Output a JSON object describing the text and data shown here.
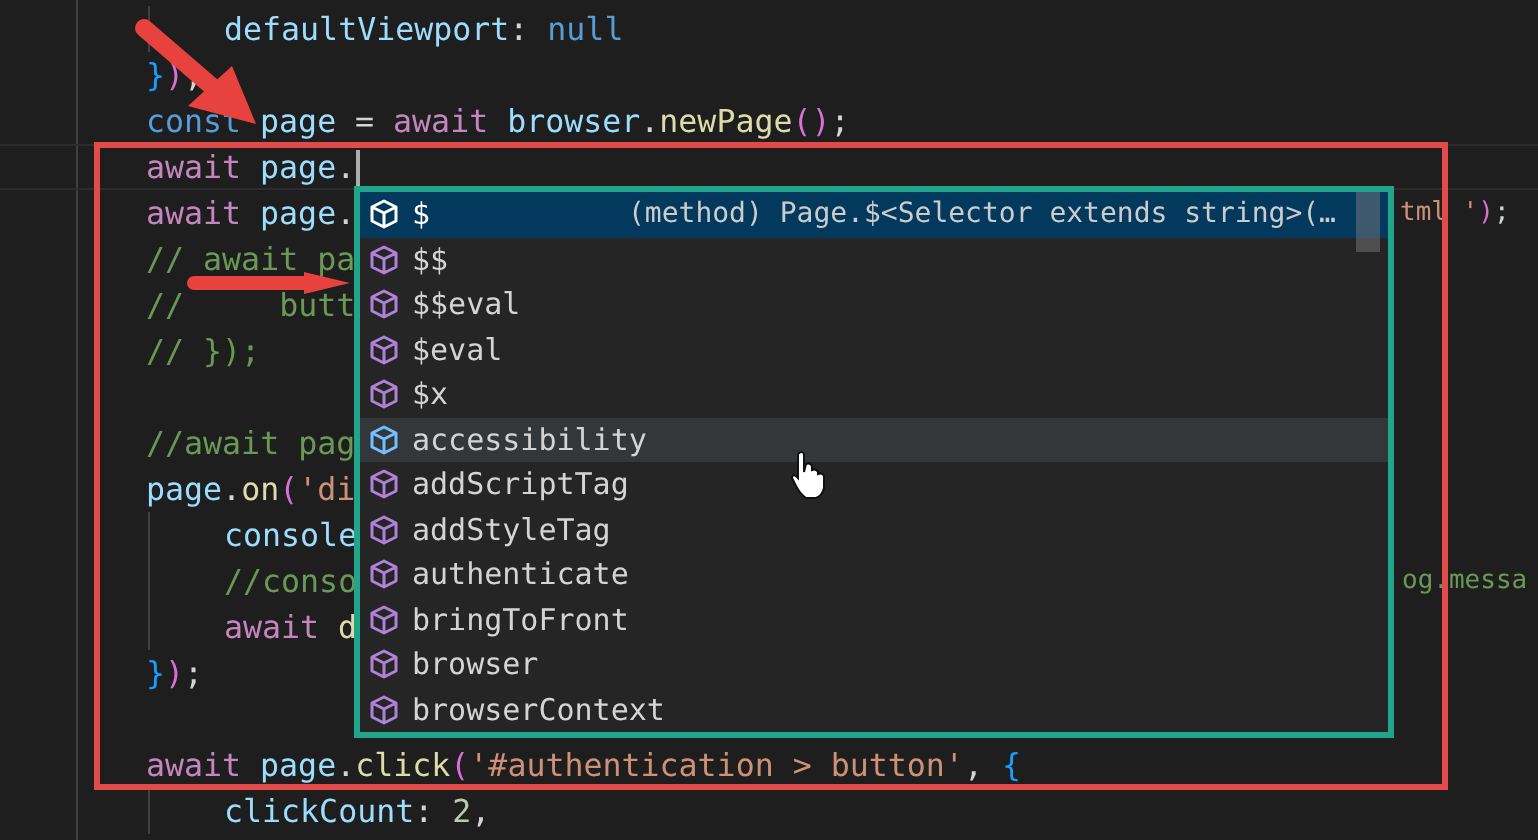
{
  "editor": {
    "lines": [
      {
        "kind": "code",
        "children": [
          {
            "kind": "code",
            "tokens": [
              {
                "kind": "var",
                "text": "defaultViewport"
              },
              {
                "kind": "punct",
                "text": ":"
              },
              {
                "kind": "storage",
                "text": "null",
                "space": true
              }
            ]
          }
        ]
      },
      {
        "kind": "code",
        "tokens": [
          {
            "kind": "brace",
            "text": "}"
          },
          {
            "kind": "paren",
            "text": ")"
          },
          {
            "kind": "punct",
            "text": ";"
          }
        ]
      },
      {
        "kind": "code",
        "tokens": [
          {
            "kind": "storage",
            "text": "const"
          },
          {
            "kind": "var",
            "text": "page",
            "space": true
          },
          {
            "kind": "punct",
            "text": "=",
            "space": true
          },
          {
            "kind": "kw",
            "text": "await",
            "space": true
          },
          {
            "kind": "var",
            "text": "browser",
            "space": true
          },
          {
            "kind": "punct",
            "text": "."
          },
          {
            "kind": "fn",
            "text": "newPage"
          },
          {
            "kind": "paren",
            "text": "()"
          },
          {
            "kind": "punct",
            "text": ";"
          }
        ]
      },
      {
        "kind": "code",
        "current": true,
        "tokens": [
          {
            "kind": "kw",
            "text": "await"
          },
          {
            "kind": "var",
            "text": "page",
            "space": true
          },
          {
            "kind": "punct",
            "text": "."
          }
        ]
      },
      {
        "kind": "code",
        "tokens": [
          {
            "kind": "kw",
            "text": "await"
          },
          {
            "kind": "var",
            "text": "page",
            "space": true
          },
          {
            "kind": "punct",
            "text": "."
          }
        ],
        "tail": [
          {
            "kind": "str",
            "text": "tml"
          },
          {
            "kind": "str",
            "text": "'",
            "space": true
          },
          {
            "kind": "paren",
            "text": ")"
          },
          {
            "kind": "punct",
            "text": ";"
          }
        ]
      },
      {
        "kind": "code",
        "tokens": [
          {
            "kind": "comment",
            "text": "// await pa"
          }
        ]
      },
      {
        "kind": "code",
        "tokens": [
          {
            "kind": "comment",
            "text": "//     butt"
          }
        ]
      },
      {
        "kind": "code",
        "tokens": [
          {
            "kind": "comment",
            "text": "// });"
          }
        ]
      },
      {
        "kind": "blank"
      },
      {
        "kind": "code",
        "tokens": [
          {
            "kind": "comment",
            "text": "//await pag"
          }
        ]
      },
      {
        "kind": "code",
        "tokens": [
          {
            "kind": "var",
            "text": "page"
          },
          {
            "kind": "punct",
            "text": "."
          },
          {
            "kind": "fn",
            "text": "on"
          },
          {
            "kind": "paren",
            "text": "("
          },
          {
            "kind": "str",
            "text": "'di"
          }
        ],
        "children": [
          {
            "kind": "code",
            "tokens": [
              {
                "kind": "var",
                "text": "console"
              }
            ]
          },
          {
            "kind": "code",
            "tokens": [
              {
                "kind": "comment",
                "text": "//conso"
              }
            ],
            "tail": [
              {
                "kind": "comment",
                "text": "og.messa"
              }
            ]
          },
          {
            "kind": "code",
            "tokens": [
              {
                "kind": "kw",
                "text": "await"
              },
              {
                "kind": "fn",
                "text": "d",
                "space": true
              }
            ]
          }
        ]
      },
      {
        "kind": "code",
        "tokens": [
          {
            "kind": "brace",
            "text": "}"
          },
          {
            "kind": "paren",
            "text": ")"
          },
          {
            "kind": "punct",
            "text": ";"
          }
        ]
      },
      {
        "kind": "blank"
      },
      {
        "kind": "code",
        "tokens": [
          {
            "kind": "kw",
            "text": "await"
          },
          {
            "kind": "var",
            "text": "page",
            "space": true
          },
          {
            "kind": "punct",
            "text": "."
          },
          {
            "kind": "fn",
            "text": "click"
          },
          {
            "kind": "paren",
            "text": "("
          },
          {
            "kind": "str",
            "text": "'#authentication > button'"
          },
          {
            "kind": "punct",
            "text": ","
          },
          {
            "kind": "brace",
            "text": "{",
            "space": true
          }
        ],
        "children": [
          {
            "kind": "code",
            "tokens": [
              {
                "kind": "var",
                "text": "clickCount"
              },
              {
                "kind": "punct",
                "text": ":"
              },
              {
                "kind": "num",
                "text": "2",
                "space": true
              },
              {
                "kind": "punct",
                "text": ","
              }
            ]
          }
        ]
      }
    ]
  },
  "suggestions": {
    "detail": "(method) Page.$<Selector extends string>(…",
    "items": [
      {
        "label": "$",
        "kind": "method",
        "selected": true,
        "hovered": false
      },
      {
        "label": "$$",
        "kind": "method",
        "selected": false,
        "hovered": false
      },
      {
        "label": "$$eval",
        "kind": "method",
        "selected": false,
        "hovered": false
      },
      {
        "label": "$eval",
        "kind": "method",
        "selected": false,
        "hovered": false
      },
      {
        "label": "$x",
        "kind": "method",
        "selected": false,
        "hovered": false
      },
      {
        "label": "accessibility",
        "kind": "property",
        "selected": false,
        "hovered": true
      },
      {
        "label": "addScriptTag",
        "kind": "method",
        "selected": false,
        "hovered": false
      },
      {
        "label": "addStyleTag",
        "kind": "method",
        "selected": false,
        "hovered": false
      },
      {
        "label": "authenticate",
        "kind": "method",
        "selected": false,
        "hovered": false
      },
      {
        "label": "bringToFront",
        "kind": "method",
        "selected": false,
        "hovered": false
      },
      {
        "label": "browser",
        "kind": "method",
        "selected": false,
        "hovered": false
      },
      {
        "label": "browserContext",
        "kind": "method",
        "selected": false,
        "hovered": false
      }
    ]
  }
}
